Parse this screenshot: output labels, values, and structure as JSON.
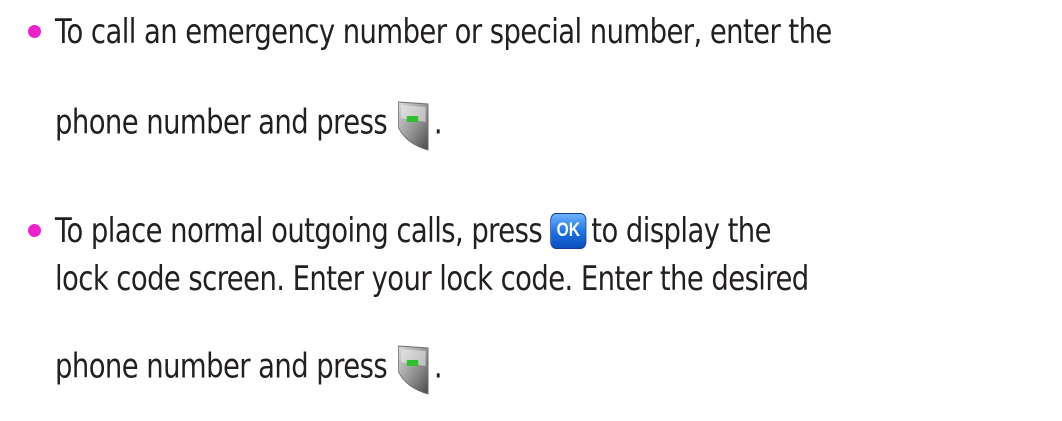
{
  "bullets": [
    {
      "line1": "To call an emergency number or special number, enter the",
      "line2_before": "phone number and press",
      "line2_after": "."
    },
    {
      "line1_before": "To place normal outgoing calls, press",
      "line1_after": "to display the",
      "line2": "lock code screen. Enter your lock code. Enter the desired",
      "line3_before": "phone number and press",
      "line3_after": "."
    }
  ],
  "icons": {
    "talk_key": "talk-key-icon",
    "ok_key": "ok-key-icon",
    "ok_key_label": "OK"
  },
  "colors": {
    "bullet": "#ee22cc",
    "text": "#231f20",
    "ok_key": "#1b6fe0"
  }
}
